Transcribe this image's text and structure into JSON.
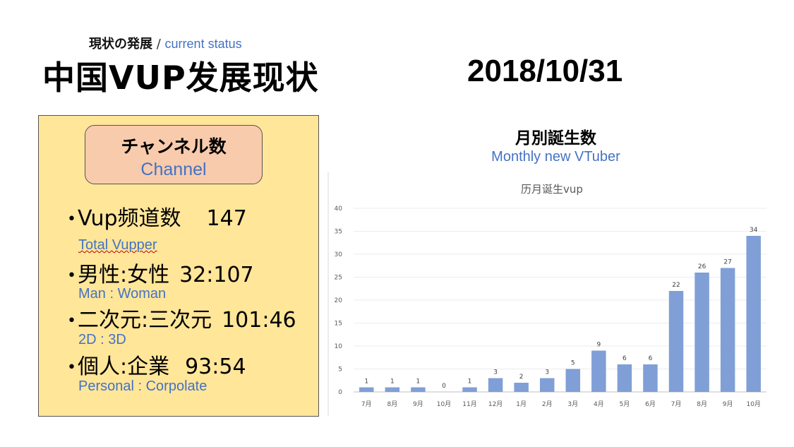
{
  "header": {
    "subtitle_jp": "現状の発展",
    "subtitle_sep": "/",
    "subtitle_en": "current status",
    "title": "中国VUP发展现状",
    "date": "2018/10/31"
  },
  "panel": {
    "heading_jp": "チャンネル数",
    "heading_en": "Channel",
    "stats": [
      {
        "label": "Vup频道数",
        "value": "147",
        "sub": "Total Vupper"
      },
      {
        "label": "男性:女性",
        "value": "32:107",
        "sub": "Man : Woman"
      },
      {
        "label": "二次元:三次元",
        "value": "101:46",
        "sub": "2D : 3D"
      },
      {
        "label": "個人:企業",
        "value": "93:54",
        "sub": "Personal : Corpolate"
      }
    ]
  },
  "chart_heading": {
    "title": "月別誕生数",
    "subtitle": "Monthly new VTuber"
  },
  "chart_data": {
    "type": "bar",
    "title": "历月诞生vup",
    "categories": [
      "7月",
      "8月",
      "9月",
      "10月",
      "11月",
      "12月",
      "1月",
      "2月",
      "3月",
      "4月",
      "5月",
      "6月",
      "7月",
      "8月",
      "9月",
      "10月"
    ],
    "values": [
      1,
      1,
      1,
      0,
      1,
      3,
      2,
      3,
      5,
      9,
      6,
      6,
      22,
      26,
      27,
      34
    ],
    "ylim": [
      0,
      40
    ],
    "yticks": [
      0,
      5,
      10,
      15,
      20,
      25,
      30,
      35,
      40
    ],
    "grid": true,
    "data_labels": true,
    "bar_color": "#7f9fd6",
    "legend": "none"
  },
  "colors": {
    "accent_blue": "#4472c4",
    "panel_bg": "#ffe699",
    "channel_bg": "#f8cbad"
  }
}
